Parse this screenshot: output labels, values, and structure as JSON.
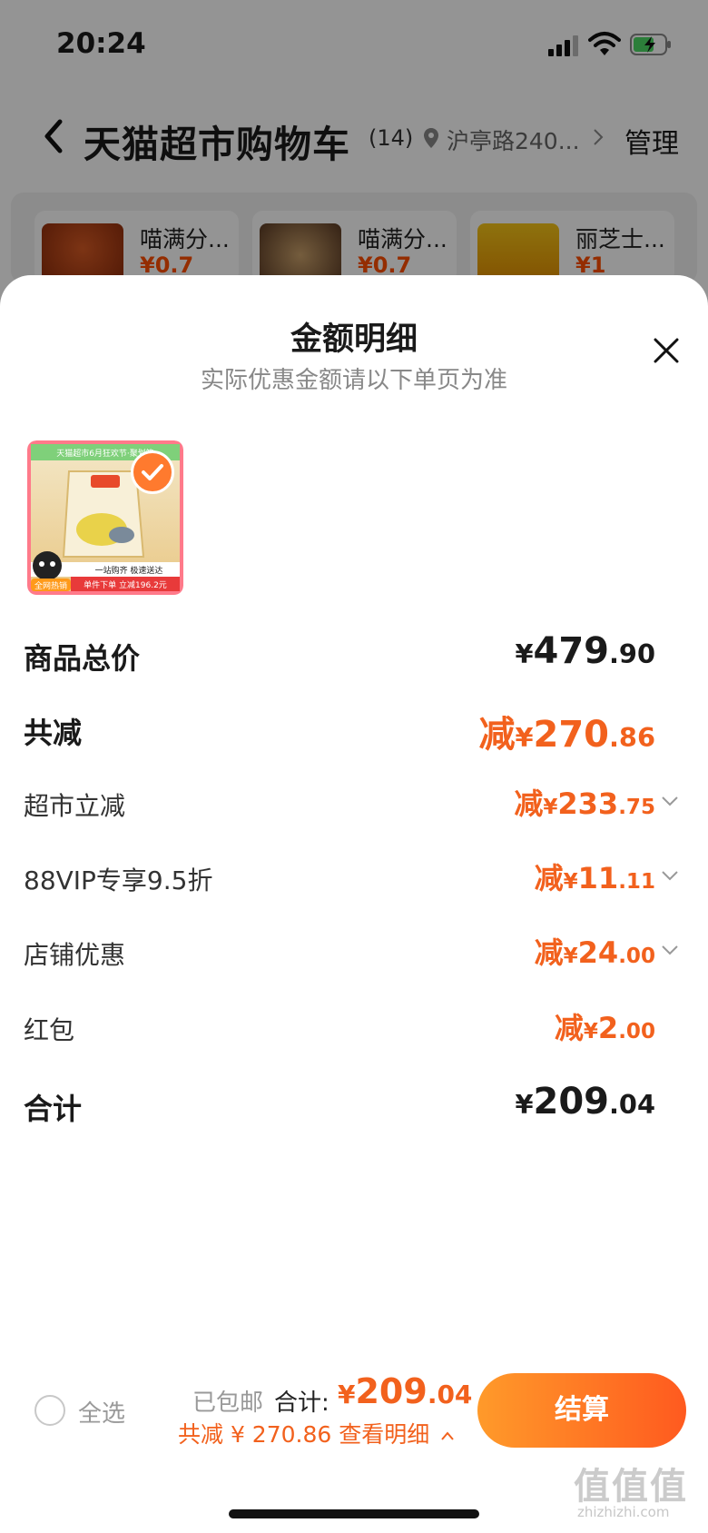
{
  "status_bar": {
    "time": "20:24"
  },
  "nav": {
    "title": "天猫超市购物车",
    "count": "(14)",
    "address": "沪亭路240...",
    "manage_label": "管理"
  },
  "recommendations": [
    {
      "name": "喵满分...",
      "price": "¥0.7"
    },
    {
      "name": "喵满分...",
      "price": "¥0.7"
    },
    {
      "name": "丽芝士...",
      "price": "¥1"
    }
  ],
  "sheet": {
    "title": "金额明细",
    "subtitle": "实际优惠金额请以下单页为准",
    "product_thumb": {
      "banner_text": "天猫超市6月狂欢节·聚划算",
      "slogan": "一站购齐 极速送达",
      "promo": "单件下单 立减196.2元",
      "badge": "全网热销"
    },
    "rows": [
      {
        "label": "商品总价",
        "prefix": "",
        "currency": "¥",
        "int": "479",
        "dec": ".90",
        "style": "big-dark"
      },
      {
        "label": "共减",
        "prefix": "减",
        "currency": "¥",
        "int": "270",
        "dec": ".86",
        "style": "big-orange"
      },
      {
        "label": "超市立减",
        "prefix": "减",
        "currency": "¥",
        "int": "233",
        "dec": ".75",
        "style": "small-orange",
        "expandable": true
      },
      {
        "label": "88VIP专享9.5折",
        "prefix": "减",
        "currency": "¥",
        "int": "11",
        "dec": ".11",
        "style": "small-orange",
        "expandable": true
      },
      {
        "label": "店铺优惠",
        "prefix": "减",
        "currency": "¥",
        "int": "24",
        "dec": ".00",
        "style": "small-orange",
        "expandable": true
      },
      {
        "label": "红包",
        "prefix": "减",
        "currency": "¥",
        "int": "2",
        "dec": ".00",
        "style": "small-orange",
        "expandable": false
      },
      {
        "label": "合计",
        "prefix": "",
        "currency": "¥",
        "int": "209",
        "dec": ".04",
        "style": "big-dark"
      }
    ]
  },
  "checkout_bar": {
    "select_all_label": "全选",
    "shipping_text": "已包邮",
    "total_label": "合计:",
    "total_currency": "¥",
    "total_int": "209",
    "total_dec": ".04",
    "save_text": "共减 ¥ 270.86",
    "detail_link": "查看明细",
    "checkout_label": "结算"
  },
  "watermark": {
    "text": "值值值",
    "sub": "zhizhizhi.com"
  },
  "colors": {
    "accent": "#f2611d",
    "button_start": "#ff9a2a",
    "button_end": "#ff5a1f"
  },
  "icons": [
    "back-icon",
    "location-pin-icon",
    "chevron-right-icon",
    "close-icon",
    "check-icon",
    "chevron-down-icon",
    "chevron-up-icon",
    "signal-icon",
    "wifi-icon",
    "battery-icon"
  ]
}
